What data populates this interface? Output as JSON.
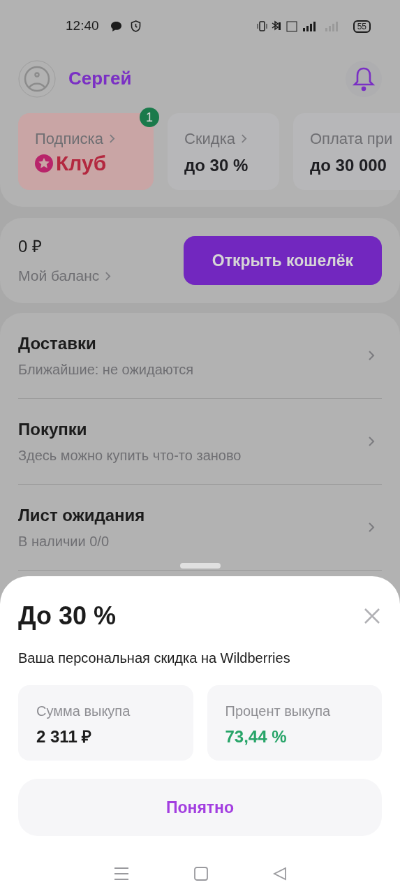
{
  "status_bar": {
    "time": "12:40",
    "battery": "55"
  },
  "header": {
    "user_name": "Сергей"
  },
  "promo_cards": [
    {
      "kind": "club",
      "label": "Подписка",
      "value": "Клуб",
      "badge": "1"
    },
    {
      "kind": "plain",
      "label": "Скидка",
      "value": "до 30 %"
    },
    {
      "kind": "cut",
      "label": "Оплата при",
      "value": "до 30 000"
    }
  ],
  "balance": {
    "amount": "0 ₽",
    "label": "Мой баланс",
    "button": "Открыть кошелёк"
  },
  "menu": [
    {
      "title": "Доставки",
      "subtitle": "Ближайшие: не ожидаются"
    },
    {
      "title": "Покупки",
      "subtitle": "Здесь можно купить что-то заново"
    },
    {
      "title": "Лист ожидания",
      "subtitle": "В наличии 0/0"
    }
  ],
  "sheet": {
    "title": "До 30 %",
    "subtitle": "Ваша персональная скидка на Wildberries",
    "stats": [
      {
        "label": "Сумма выкупа",
        "value": "2 311 ₽",
        "kind": "neutral"
      },
      {
        "label": "Процент выкупа",
        "value": "73,44 %",
        "kind": "positive"
      }
    ],
    "button": "Понятно"
  }
}
